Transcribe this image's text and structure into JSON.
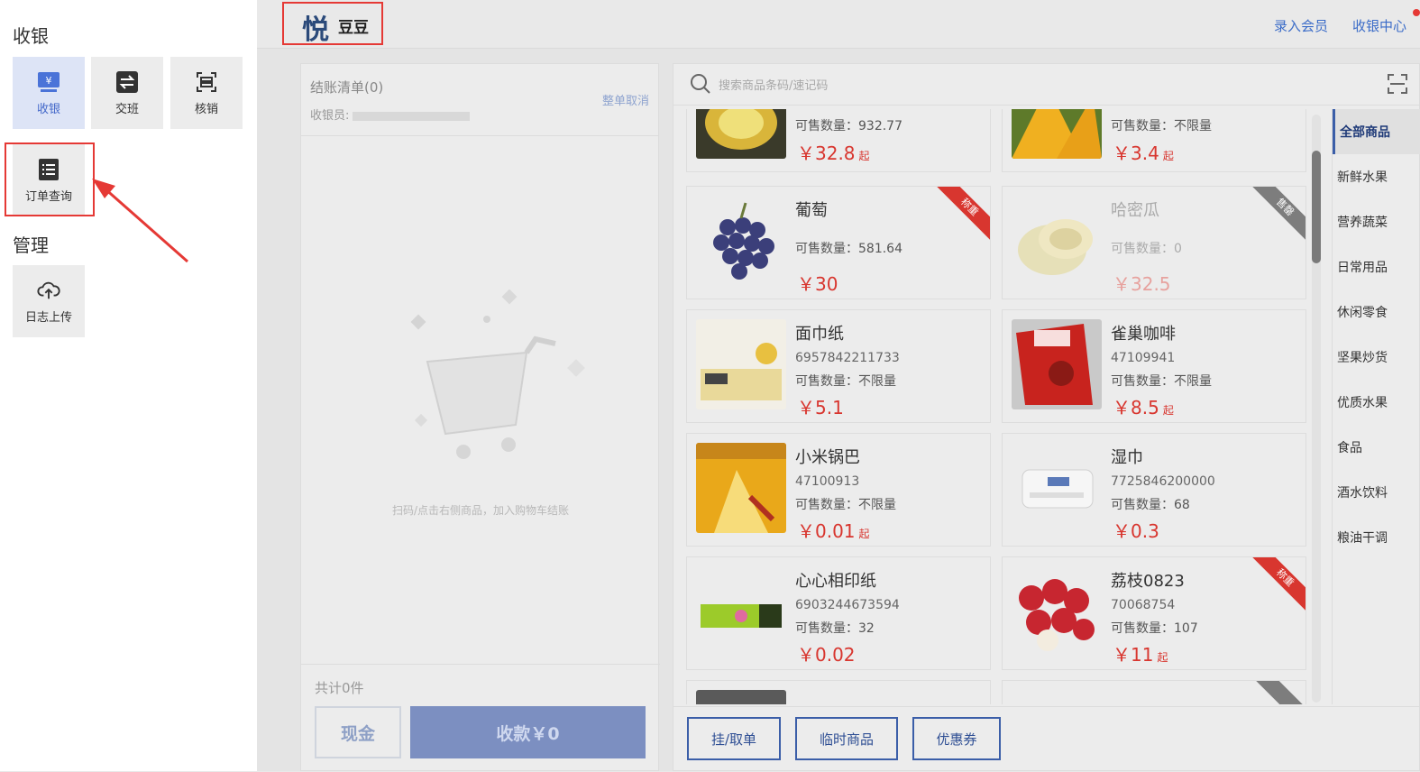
{
  "sidebar": {
    "section_cashier": "收银",
    "section_manage": "管理",
    "tiles": {
      "cashier": "收银",
      "handover": "交班",
      "verify": "核销",
      "order_query": "订单查询",
      "log_upload": "日志上传"
    }
  },
  "topbar": {
    "logo": "悦",
    "store_name": "豆豆",
    "link_member": "录入会员",
    "link_center": "收银中心"
  },
  "cart": {
    "title": "结账清单(0)",
    "cashier_label": "收银员:",
    "cancel": "整单取消",
    "empty_tip": "扫码/点击右侧商品，加入购物车结账",
    "total": "共计0件",
    "cash_button": "现金",
    "pay_button": "收款￥0"
  },
  "search": {
    "placeholder": "搜索商品条码/速记码"
  },
  "products": [
    {
      "name": "",
      "code": "",
      "stock": "可售数量：932.77",
      "price": "￥32.8",
      "qi": "起"
    },
    {
      "name": "",
      "code": "",
      "stock": "可售数量：不限量",
      "price": "￥3.4",
      "qi": "起"
    },
    {
      "name": "葡萄",
      "code": "",
      "stock": "可售数量：581.64",
      "price": "￥30",
      "qi": "",
      "ribbon": "称重"
    },
    {
      "name": "哈密瓜",
      "code": "",
      "stock": "可售数量：0",
      "price": "￥32.5",
      "qi": "",
      "ribbon": "售罄"
    },
    {
      "name": "面巾纸",
      "code": "6957842211733",
      "stock": "可售数量：不限量",
      "price": "￥5.1",
      "qi": ""
    },
    {
      "name": "雀巢咖啡",
      "code": "47109941",
      "stock": "可售数量：不限量",
      "price": "￥8.5",
      "qi": "起"
    },
    {
      "name": "小米锅巴",
      "code": "47100913",
      "stock": "可售数量：不限量",
      "price": "￥0.01",
      "qi": "起"
    },
    {
      "name": "湿巾",
      "code": "7725846200000",
      "stock": "可售数量：68",
      "price": "￥0.3",
      "qi": ""
    },
    {
      "name": "心心相印纸",
      "code": "6903244673594",
      "stock": "可售数量：32",
      "price": "￥0.02",
      "qi": ""
    },
    {
      "name": "荔枝0823",
      "code": "70068754",
      "stock": "可售数量：107",
      "price": "￥11",
      "qi": "起",
      "ribbon": "称重"
    }
  ],
  "categories": [
    "全部商品",
    "新鲜水果",
    "营养蔬菜",
    "日常用品",
    "休闲零食",
    "坚果炒货",
    "优质水果",
    "食品",
    "酒水饮料",
    "粮油干调"
  ],
  "bottom_buttons": {
    "hold": "挂/取单",
    "temp": "临时商品",
    "coupon": "优惠券"
  },
  "colors": {
    "accent": "#3b5ea8",
    "price": "#d8362f",
    "highlight_box": "#e53935"
  }
}
